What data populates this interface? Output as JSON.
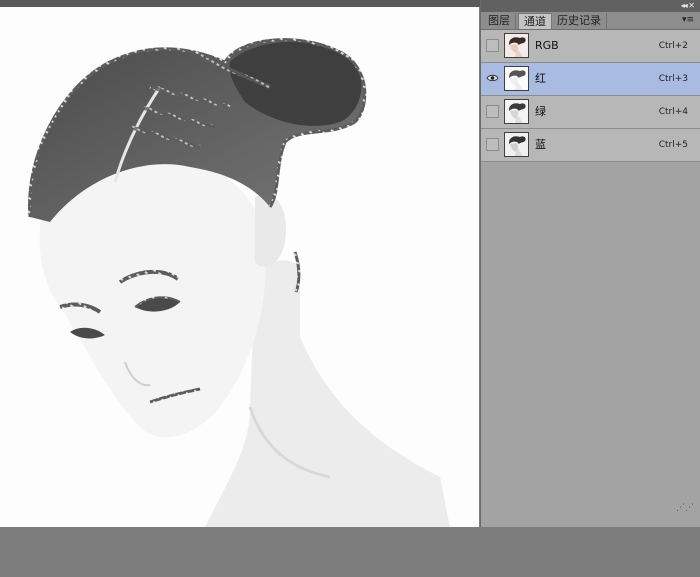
{
  "panel": {
    "collapse_icon": "double-chevron-icon",
    "menu_icon": "panel-menu-icon",
    "tabs": [
      {
        "label": "图层",
        "active": false
      },
      {
        "label": "通道",
        "active": true
      },
      {
        "label": "历史记录",
        "active": false
      }
    ],
    "channels": [
      {
        "name": "RGB",
        "shortcut": "Ctrl+2",
        "visible": false,
        "selected": false,
        "thumb": "color"
      },
      {
        "name": "红",
        "shortcut": "Ctrl+3",
        "visible": true,
        "selected": true,
        "thumb": "gray"
      },
      {
        "name": "绿",
        "shortcut": "Ctrl+4",
        "visible": false,
        "selected": false,
        "thumb": "gray"
      },
      {
        "name": "蓝",
        "shortcut": "Ctrl+5",
        "visible": false,
        "selected": false,
        "thumb": "gray"
      }
    ]
  },
  "colors": {
    "selection_highlight": "#a9bbe0",
    "panel_bg": "#a3a3a3",
    "workspace": "#7e7e7e"
  }
}
